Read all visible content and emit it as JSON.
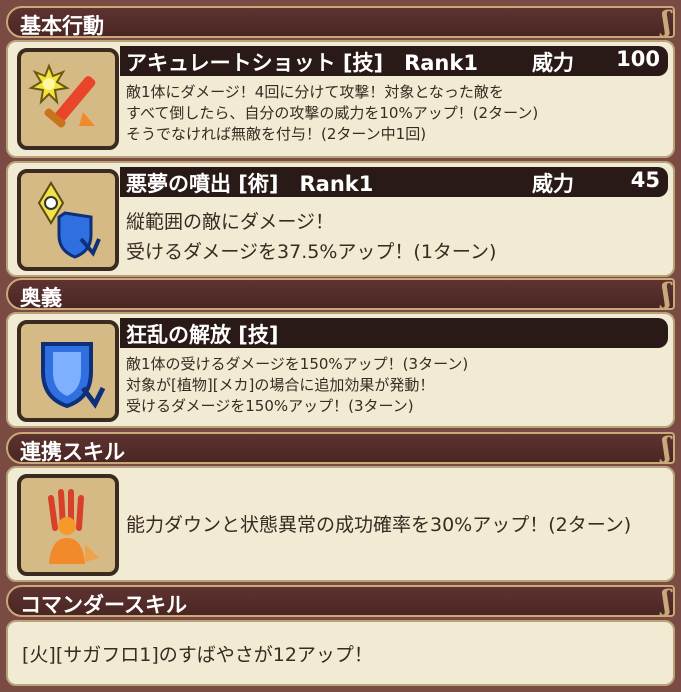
{
  "sections": {
    "basic": "基本行動",
    "ougi": "奥義",
    "renkei": "連携スキル",
    "commander": "コマンダースキル"
  },
  "skills": [
    {
      "name": "アキュレートショット [技]　Rank1",
      "power_label": "威力",
      "power": "100",
      "lines": [
        "敵1体にダメージ！4回に分けて攻撃！対象となった敵を",
        "すべて倒したら、自分の攻撃の威力を10%アップ！(2ターン)",
        "そうでなければ無敵を付与！(2ターン中1回)"
      ],
      "icon": "sword-flame-icon"
    },
    {
      "name": "悪夢の噴出 [術]　Rank1",
      "power_label": "威力",
      "power": "45",
      "lines": [
        "縦範囲の敵にダメージ！",
        "受けるダメージを37.5%アップ！(1ターン)"
      ],
      "icon": "shield-eye-icon"
    }
  ],
  "ougi": {
    "name": "狂乱の解放 [技]",
    "lines": [
      "敵1体の受けるダメージを150%アップ！(3ターン)",
      "対象が[植物][メカ]の場合に追加効果が発動！",
      "受けるダメージを150%アップ！(3ターン)"
    ],
    "icon": "shield-down-icon"
  },
  "renkei": {
    "text": "能力ダウンと状態異常の成功確率を30%アップ！(2ターン)",
    "icon": "hand-figure-icon"
  },
  "commander": {
    "text": "[火][サガフロ1]のすばやさが12アップ！"
  }
}
